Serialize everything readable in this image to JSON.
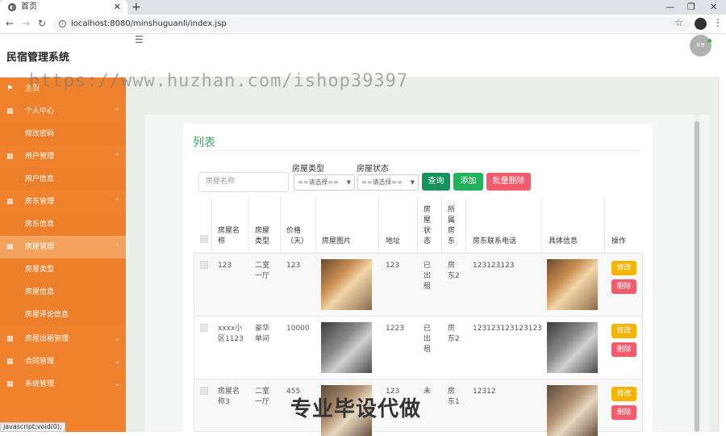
{
  "browser": {
    "tab_title": "首页",
    "url": "localhost:8080/minshuguanli/index.jsp",
    "status_url": "javascript:void(0);"
  },
  "app": {
    "title": "民宿管理系统",
    "avatar_text": "民宿",
    "watermark": "https://www.huzhan.com/ishop39397"
  },
  "sidebar": {
    "items": [
      {
        "label": "主页",
        "type": "top",
        "icon": "flag-icon"
      },
      {
        "label": "个人中心",
        "type": "top",
        "icon": "grid-icon",
        "chev": "⌃"
      },
      {
        "label": "修改密码",
        "type": "sub"
      },
      {
        "label": "用户管理",
        "type": "top",
        "icon": "grid-icon",
        "chev": "⌃"
      },
      {
        "label": "用户信息",
        "type": "sub"
      },
      {
        "label": "房东管理",
        "type": "top",
        "icon": "grid-icon",
        "chev": "⌃"
      },
      {
        "label": "房东信息",
        "type": "sub"
      },
      {
        "label": "房屋管理",
        "type": "top",
        "icon": "grid-icon",
        "chev": "⌃"
      },
      {
        "label": "房屋类型",
        "type": "sub"
      },
      {
        "label": "房屋信息",
        "type": "sub"
      },
      {
        "label": "房屋评论信息",
        "type": "sub"
      },
      {
        "label": "房屋出租管理",
        "type": "top",
        "icon": "grid-icon",
        "chev": "⌄"
      },
      {
        "label": "合同管理",
        "type": "top",
        "icon": "grid-icon",
        "chev": "⌄"
      },
      {
        "label": "系统管理",
        "type": "top",
        "icon": "grid-icon",
        "chev": "⌄"
      }
    ]
  },
  "list": {
    "title": "列表",
    "search_placeholder": "房屋名称",
    "filter1_label": "房屋类型",
    "filter1_value": "==请选择==",
    "filter2_label": "房屋状态",
    "filter2_value": "==请选择==",
    "btn_search": "查询",
    "btn_add": "添加",
    "btn_batch_delete": "批量删除",
    "headers": {
      "name": "房屋名\n称",
      "type": "房屋\n类型",
      "price": "价格\n（天）",
      "image": "房屋图片",
      "address": "地址",
      "status": "房\n屋\n状\n态",
      "owner": "所\n属\n房\n东",
      "phone": "房东联系电话",
      "detail": "具体信息",
      "action": "操作"
    },
    "rows": [
      {
        "name": "123",
        "type": "二室\n一厅",
        "price": "123",
        "address": "123",
        "status": "已\n出\n租",
        "owner": "房\n东2",
        "phone": "123123123",
        "edit": "修改",
        "delete": "删除"
      },
      {
        "name": "xxxx小\n区1123",
        "type": "豪华\n单间",
        "price": "10000",
        "address": "1223",
        "status": "已\n出\n租",
        "owner": "房\n东2",
        "phone": "123123123123123",
        "edit": "修改",
        "delete": "删除"
      },
      {
        "name": "房屋名\n称3",
        "type": "二室\n一厅",
        "price": "455",
        "address": "123",
        "status": "未",
        "owner": "房\n东1",
        "phone": "12312",
        "edit": "修改",
        "delete": "删除"
      }
    ]
  },
  "overlay_text": "专业毕设代做",
  "colors": {
    "sidebar": "#f0822e",
    "accent_green": "#3ca56a",
    "btn_search": "#15935b",
    "btn_add": "#22b35a",
    "btn_delete": "#f25b6c",
    "btn_edit": "#f6b400"
  }
}
